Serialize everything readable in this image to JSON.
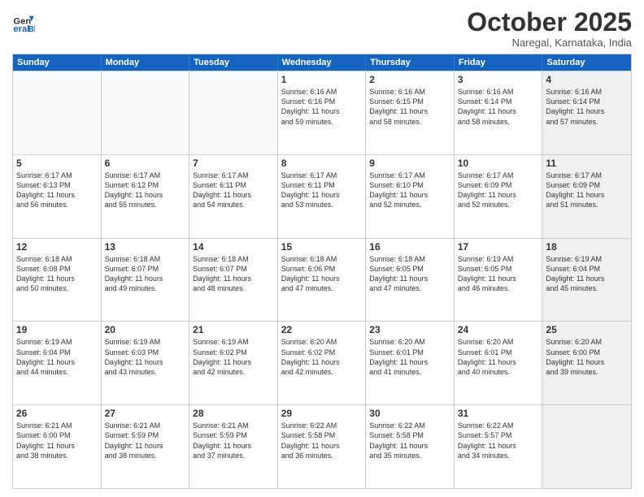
{
  "header": {
    "logo_general": "General",
    "logo_blue": "Blue",
    "month_title": "October 2025",
    "subtitle": "Naregal, Karnataka, India"
  },
  "weekdays": [
    "Sunday",
    "Monday",
    "Tuesday",
    "Wednesday",
    "Thursday",
    "Friday",
    "Saturday"
  ],
  "rows": [
    [
      {
        "day": "",
        "text": "",
        "empty": true
      },
      {
        "day": "",
        "text": "",
        "empty": true
      },
      {
        "day": "",
        "text": "",
        "empty": true
      },
      {
        "day": "1",
        "text": "Sunrise: 6:16 AM\nSunset: 6:16 PM\nDaylight: 11 hours\nand 59 minutes."
      },
      {
        "day": "2",
        "text": "Sunrise: 6:16 AM\nSunset: 6:15 PM\nDaylight: 11 hours\nand 58 minutes."
      },
      {
        "day": "3",
        "text": "Sunrise: 6:16 AM\nSunset: 6:14 PM\nDaylight: 11 hours\nand 58 minutes."
      },
      {
        "day": "4",
        "text": "Sunrise: 6:16 AM\nSunset: 6:14 PM\nDaylight: 11 hours\nand 57 minutes.",
        "shaded": true
      }
    ],
    [
      {
        "day": "5",
        "text": "Sunrise: 6:17 AM\nSunset: 6:13 PM\nDaylight: 11 hours\nand 56 minutes."
      },
      {
        "day": "6",
        "text": "Sunrise: 6:17 AM\nSunset: 6:12 PM\nDaylight: 11 hours\nand 55 minutes."
      },
      {
        "day": "7",
        "text": "Sunrise: 6:17 AM\nSunset: 6:11 PM\nDaylight: 11 hours\nand 54 minutes."
      },
      {
        "day": "8",
        "text": "Sunrise: 6:17 AM\nSunset: 6:11 PM\nDaylight: 11 hours\nand 53 minutes."
      },
      {
        "day": "9",
        "text": "Sunrise: 6:17 AM\nSunset: 6:10 PM\nDaylight: 11 hours\nand 52 minutes."
      },
      {
        "day": "10",
        "text": "Sunrise: 6:17 AM\nSunset: 6:09 PM\nDaylight: 11 hours\nand 52 minutes."
      },
      {
        "day": "11",
        "text": "Sunrise: 6:17 AM\nSunset: 6:09 PM\nDaylight: 11 hours\nand 51 minutes.",
        "shaded": true
      }
    ],
    [
      {
        "day": "12",
        "text": "Sunrise: 6:18 AM\nSunset: 6:08 PM\nDaylight: 11 hours\nand 50 minutes."
      },
      {
        "day": "13",
        "text": "Sunrise: 6:18 AM\nSunset: 6:07 PM\nDaylight: 11 hours\nand 49 minutes."
      },
      {
        "day": "14",
        "text": "Sunrise: 6:18 AM\nSunset: 6:07 PM\nDaylight: 11 hours\nand 48 minutes."
      },
      {
        "day": "15",
        "text": "Sunrise: 6:18 AM\nSunset: 6:06 PM\nDaylight: 11 hours\nand 47 minutes."
      },
      {
        "day": "16",
        "text": "Sunrise: 6:18 AM\nSunset: 6:05 PM\nDaylight: 11 hours\nand 47 minutes."
      },
      {
        "day": "17",
        "text": "Sunrise: 6:19 AM\nSunset: 6:05 PM\nDaylight: 11 hours\nand 46 minutes."
      },
      {
        "day": "18",
        "text": "Sunrise: 6:19 AM\nSunset: 6:04 PM\nDaylight: 11 hours\nand 45 minutes.",
        "shaded": true
      }
    ],
    [
      {
        "day": "19",
        "text": "Sunrise: 6:19 AM\nSunset: 6:04 PM\nDaylight: 11 hours\nand 44 minutes."
      },
      {
        "day": "20",
        "text": "Sunrise: 6:19 AM\nSunset: 6:03 PM\nDaylight: 11 hours\nand 43 minutes."
      },
      {
        "day": "21",
        "text": "Sunrise: 6:19 AM\nSunset: 6:02 PM\nDaylight: 11 hours\nand 42 minutes."
      },
      {
        "day": "22",
        "text": "Sunrise: 6:20 AM\nSunset: 6:02 PM\nDaylight: 11 hours\nand 42 minutes."
      },
      {
        "day": "23",
        "text": "Sunrise: 6:20 AM\nSunset: 6:01 PM\nDaylight: 11 hours\nand 41 minutes."
      },
      {
        "day": "24",
        "text": "Sunrise: 6:20 AM\nSunset: 6:01 PM\nDaylight: 11 hours\nand 40 minutes."
      },
      {
        "day": "25",
        "text": "Sunrise: 6:20 AM\nSunset: 6:00 PM\nDaylight: 11 hours\nand 39 minutes.",
        "shaded": true
      }
    ],
    [
      {
        "day": "26",
        "text": "Sunrise: 6:21 AM\nSunset: 6:00 PM\nDaylight: 11 hours\nand 38 minutes."
      },
      {
        "day": "27",
        "text": "Sunrise: 6:21 AM\nSunset: 5:59 PM\nDaylight: 11 hours\nand 38 minutes."
      },
      {
        "day": "28",
        "text": "Sunrise: 6:21 AM\nSunset: 5:59 PM\nDaylight: 11 hours\nand 37 minutes."
      },
      {
        "day": "29",
        "text": "Sunrise: 6:22 AM\nSunset: 5:58 PM\nDaylight: 11 hours\nand 36 minutes."
      },
      {
        "day": "30",
        "text": "Sunrise: 6:22 AM\nSunset: 5:58 PM\nDaylight: 11 hours\nand 35 minutes."
      },
      {
        "day": "31",
        "text": "Sunrise: 6:22 AM\nSunset: 5:57 PM\nDaylight: 11 hours\nand 34 minutes."
      },
      {
        "day": "",
        "text": "",
        "empty": true,
        "shaded": true
      }
    ]
  ]
}
